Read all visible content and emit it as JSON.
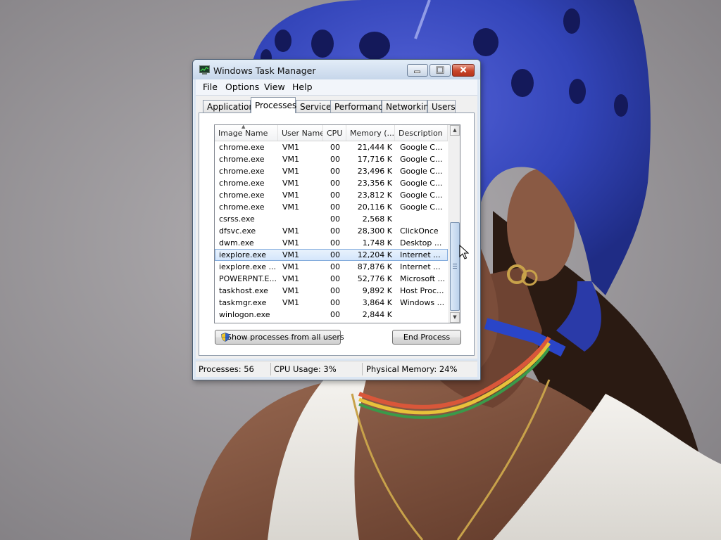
{
  "window": {
    "title": "Windows Task Manager"
  },
  "menu": [
    "File",
    "Options",
    "View",
    "Help"
  ],
  "tabs": [
    "Applications",
    "Processes",
    "Services",
    "Performance",
    "Networking",
    "Users"
  ],
  "active_tab": "Processes",
  "columns": [
    "Image Name",
    "User Name",
    "CPU",
    "Memory (...",
    "Description"
  ],
  "rows": [
    {
      "name": "chrome.exe",
      "user": "VM1",
      "cpu": "00",
      "mem": "21,444 K",
      "desc": "Google C..."
    },
    {
      "name": "chrome.exe",
      "user": "VM1",
      "cpu": "00",
      "mem": "17,716 K",
      "desc": "Google C..."
    },
    {
      "name": "chrome.exe",
      "user": "VM1",
      "cpu": "00",
      "mem": "23,496 K",
      "desc": "Google C..."
    },
    {
      "name": "chrome.exe",
      "user": "VM1",
      "cpu": "00",
      "mem": "23,356 K",
      "desc": "Google C..."
    },
    {
      "name": "chrome.exe",
      "user": "VM1",
      "cpu": "00",
      "mem": "23,812 K",
      "desc": "Google C..."
    },
    {
      "name": "chrome.exe",
      "user": "VM1",
      "cpu": "00",
      "mem": "20,116 K",
      "desc": "Google C..."
    },
    {
      "name": "csrss.exe",
      "user": "",
      "cpu": "00",
      "mem": "2,568 K",
      "desc": ""
    },
    {
      "name": "dfsvc.exe",
      "user": "VM1",
      "cpu": "00",
      "mem": "28,300 K",
      "desc": "ClickOnce"
    },
    {
      "name": "dwm.exe",
      "user": "VM1",
      "cpu": "00",
      "mem": "1,748 K",
      "desc": "Desktop ..."
    },
    {
      "name": "iexplore.exe",
      "user": "VM1",
      "cpu": "00",
      "mem": "12,204 K",
      "desc": "Internet ..."
    },
    {
      "name": "iexplore.exe ...",
      "user": "VM1",
      "cpu": "00",
      "mem": "87,876 K",
      "desc": "Internet ..."
    },
    {
      "name": "POWERPNT.E...",
      "user": "VM1",
      "cpu": "00",
      "mem": "52,776 K",
      "desc": "Microsoft ..."
    },
    {
      "name": "taskhost.exe",
      "user": "VM1",
      "cpu": "00",
      "mem": "9,892 K",
      "desc": "Host Proc..."
    },
    {
      "name": "taskmgr.exe",
      "user": "VM1",
      "cpu": "00",
      "mem": "3,864 K",
      "desc": "Windows ..."
    },
    {
      "name": "winlogon.exe",
      "user": "",
      "cpu": "00",
      "mem": "2,844 K",
      "desc": ""
    }
  ],
  "selected_row": 9,
  "buttons": {
    "show_all": "Show processes from all users",
    "end_process": "End Process"
  },
  "status": {
    "processes": "Processes: 56",
    "cpu": "CPU Usage: 3%",
    "memory": "Physical Memory: 24%"
  },
  "colors": {
    "helmet": "#3346b8",
    "titlebar": "#c6d6ea",
    "selection": "#d3e5fb"
  },
  "icons": {
    "app": "task-manager-icon",
    "uac": "uac-shield-icon"
  }
}
